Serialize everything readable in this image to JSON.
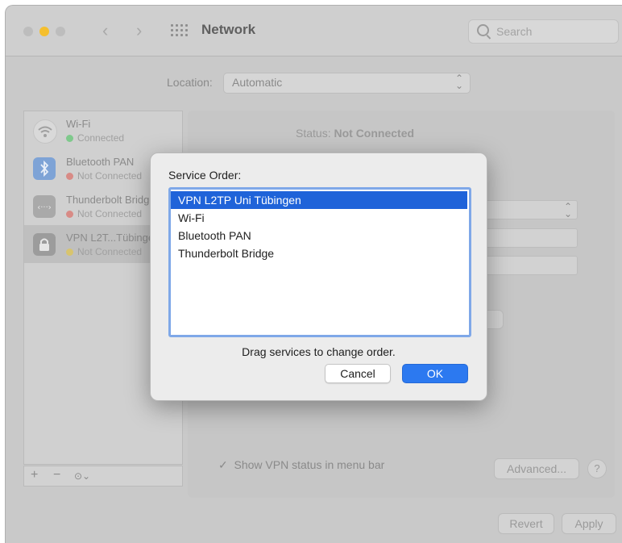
{
  "window": {
    "title": "Network",
    "search_placeholder": "Search"
  },
  "location": {
    "label": "Location:",
    "value": "Automatic"
  },
  "services": [
    {
      "name": "Wi-Fi",
      "status": "Connected",
      "status_color": "#34c759",
      "icon": "wifi-icon"
    },
    {
      "name": "Bluetooth PAN",
      "status": "Not Connected",
      "status_color": "#ff3b30",
      "icon": "bluetooth-icon"
    },
    {
      "name": "Thunderbolt Bridge",
      "status": "Not Connected",
      "status_color": "#ff3b30",
      "icon": "thunderbolt-icon"
    },
    {
      "name": "VPN L2T...Tübingen",
      "status": "Not Connected",
      "status_color": "#ffcc00",
      "icon": "lock-icon"
    }
  ],
  "detail": {
    "status_label": "Status:",
    "status_value": "Not Connected",
    "show_vpn_label": "Show VPN status in menu bar",
    "advanced_label": "Advanced...",
    "help_label": "?",
    "revert_label": "Revert",
    "apply_label": "Apply"
  },
  "dialog": {
    "title": "Service Order:",
    "items": [
      "VPN L2TP Uni Tübingen",
      "Wi-Fi",
      "Bluetooth PAN",
      "Thunderbolt Bridge"
    ],
    "hint": "Drag services to change order.",
    "cancel_label": "Cancel",
    "ok_label": "OK"
  },
  "colors": {
    "accent": "#2c79f0",
    "selection": "#1f63d9"
  }
}
